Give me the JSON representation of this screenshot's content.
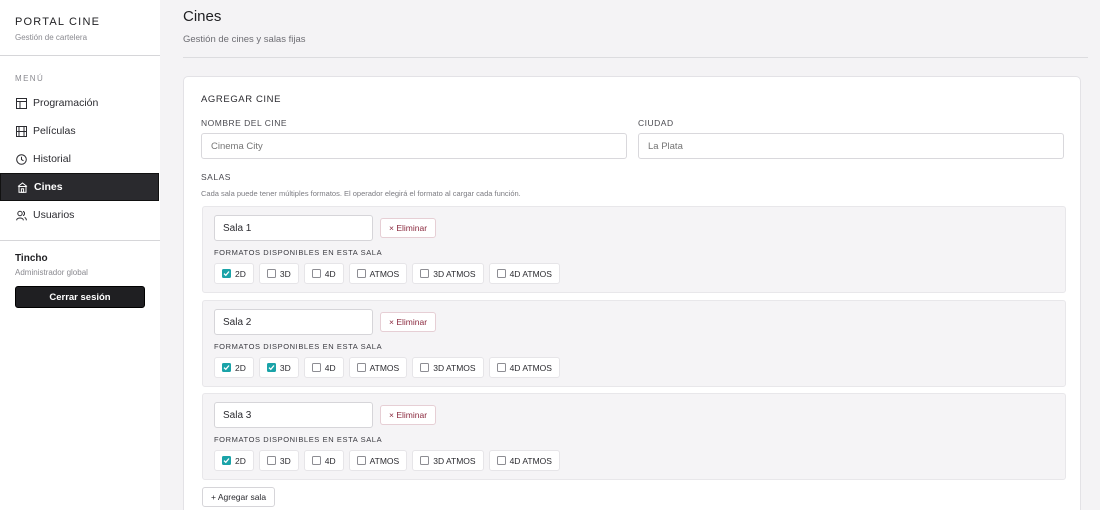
{
  "brand": {
    "title": "PORTAL CINE",
    "subtitle": "Gestión de cartelera"
  },
  "menu": {
    "label": "MENÚ",
    "items": [
      {
        "label": "Programación",
        "icon": "layout-icon",
        "active": false
      },
      {
        "label": "Películas",
        "icon": "film-icon",
        "active": false
      },
      {
        "label": "Historial",
        "icon": "clock-icon",
        "active": false
      },
      {
        "label": "Cines",
        "icon": "building-icon",
        "active": true
      },
      {
        "label": "Usuarios",
        "icon": "users-icon",
        "active": false
      }
    ]
  },
  "user": {
    "name": "Tincho",
    "role": "Administrador global",
    "logout_label": "Cerrar sesión"
  },
  "header": {
    "title": "Cines",
    "subtitle": "Gestión de cines y salas fijas"
  },
  "form": {
    "title": "AGREGAR CINE",
    "name_label": "NOMBRE DEL CINE",
    "name_placeholder": "Cinema City",
    "city_label": "CIUDAD",
    "city_placeholder": "La Plata",
    "salas_label": "SALAS",
    "salas_help": "Cada sala puede tener múltiples formatos. El operador elegirá el formato al cargar cada función.",
    "delete_label": "× Eliminar",
    "formats_label": "FORMATOS DISPONIBLES EN ESTA SALA",
    "format_options": [
      "2D",
      "3D",
      "4D",
      "ATMOS",
      "3D ATMOS",
      "4D ATMOS"
    ],
    "salas": [
      {
        "name": "Sala 1",
        "checked": [
          "2D"
        ]
      },
      {
        "name": "Sala 2",
        "checked": [
          "2D",
          "3D"
        ]
      },
      {
        "name": "Sala 3",
        "checked": [
          "2D"
        ]
      }
    ],
    "add_sala_label": "+ Agregar sala"
  },
  "colors": {
    "accent": "#1aa3a8",
    "active_nav": "#2a2a2e",
    "danger": "#8b2a3f"
  }
}
